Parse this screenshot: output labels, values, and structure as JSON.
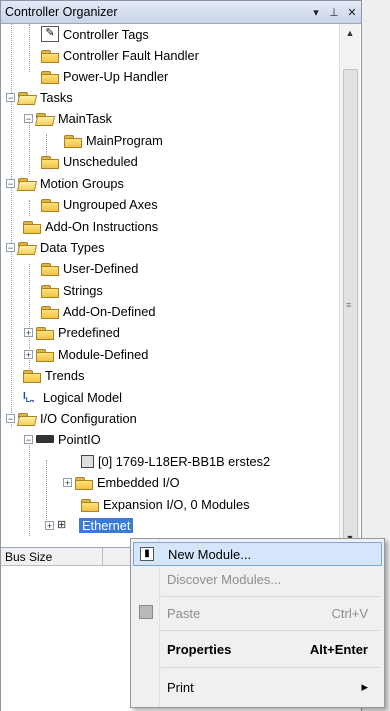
{
  "panel": {
    "title": "Controller Organizer",
    "pin": "▾ ⊥",
    "close": "✕"
  },
  "tree": [
    {
      "label": "Controller Tags",
      "icon": "tags-icon"
    },
    {
      "label": "Controller Fault Handler",
      "icon": "folder-icon"
    },
    {
      "label": "Power-Up Handler",
      "icon": "folder-icon"
    },
    {
      "label": "Tasks",
      "icon": "folder-open-icon"
    },
    {
      "label": "MainTask",
      "icon": "task-icon"
    },
    {
      "label": "MainProgram",
      "icon": "program-icon"
    },
    {
      "label": "Unscheduled",
      "icon": "folder-icon"
    },
    {
      "label": "Motion Groups",
      "icon": "folder-open-icon"
    },
    {
      "label": "Ungrouped Axes",
      "icon": "folder-icon"
    },
    {
      "label": "Add-On Instructions",
      "icon": "folder-icon"
    },
    {
      "label": "Data Types",
      "icon": "folder-open-icon"
    },
    {
      "label": "User-Defined",
      "icon": "datatype-icon"
    },
    {
      "label": "Strings",
      "icon": "datatype-icon"
    },
    {
      "label": "Add-On-Defined",
      "icon": "datatype-icon"
    },
    {
      "label": "Predefined",
      "icon": "datatype-icon"
    },
    {
      "label": "Module-Defined",
      "icon": "datatype-icon"
    },
    {
      "label": "Trends",
      "icon": "folder-icon"
    },
    {
      "label": "Logical Model",
      "icon": "logical-model-icon"
    },
    {
      "label": "I/O Configuration",
      "icon": "folder-open-icon"
    },
    {
      "label": "PointIO",
      "icon": "rack-icon"
    },
    {
      "label": "[0] 1769-L18ER-BB1B erstes2",
      "icon": "controller-icon"
    },
    {
      "label": "Embedded I/O",
      "icon": "folder-icon"
    },
    {
      "label": "Expansion I/O, 0 Modules",
      "icon": "folder-icon"
    },
    {
      "label": "Ethernet",
      "icon": "network-icon"
    }
  ],
  "lower": {
    "col1": "Bus Size"
  },
  "context_menu": {
    "items": [
      {
        "label": "New Module...",
        "shortcut": "",
        "state": "highlighted",
        "icon": "new-module-icon"
      },
      {
        "label": "Discover Modules...",
        "shortcut": "",
        "state": "disabled",
        "icon": ""
      },
      {
        "label": "Paste",
        "shortcut": "Ctrl+V",
        "state": "disabled",
        "icon": "paste-icon"
      },
      {
        "label": "Properties",
        "shortcut": "Alt+Enter",
        "state": "bold",
        "icon": ""
      },
      {
        "label": "Print",
        "shortcut": "▸",
        "state": "normal",
        "icon": ""
      }
    ]
  },
  "colors": {
    "selection": "#3a7bd5",
    "menu_highlight": "#d5e6fb",
    "folder": "#f0c34a"
  }
}
